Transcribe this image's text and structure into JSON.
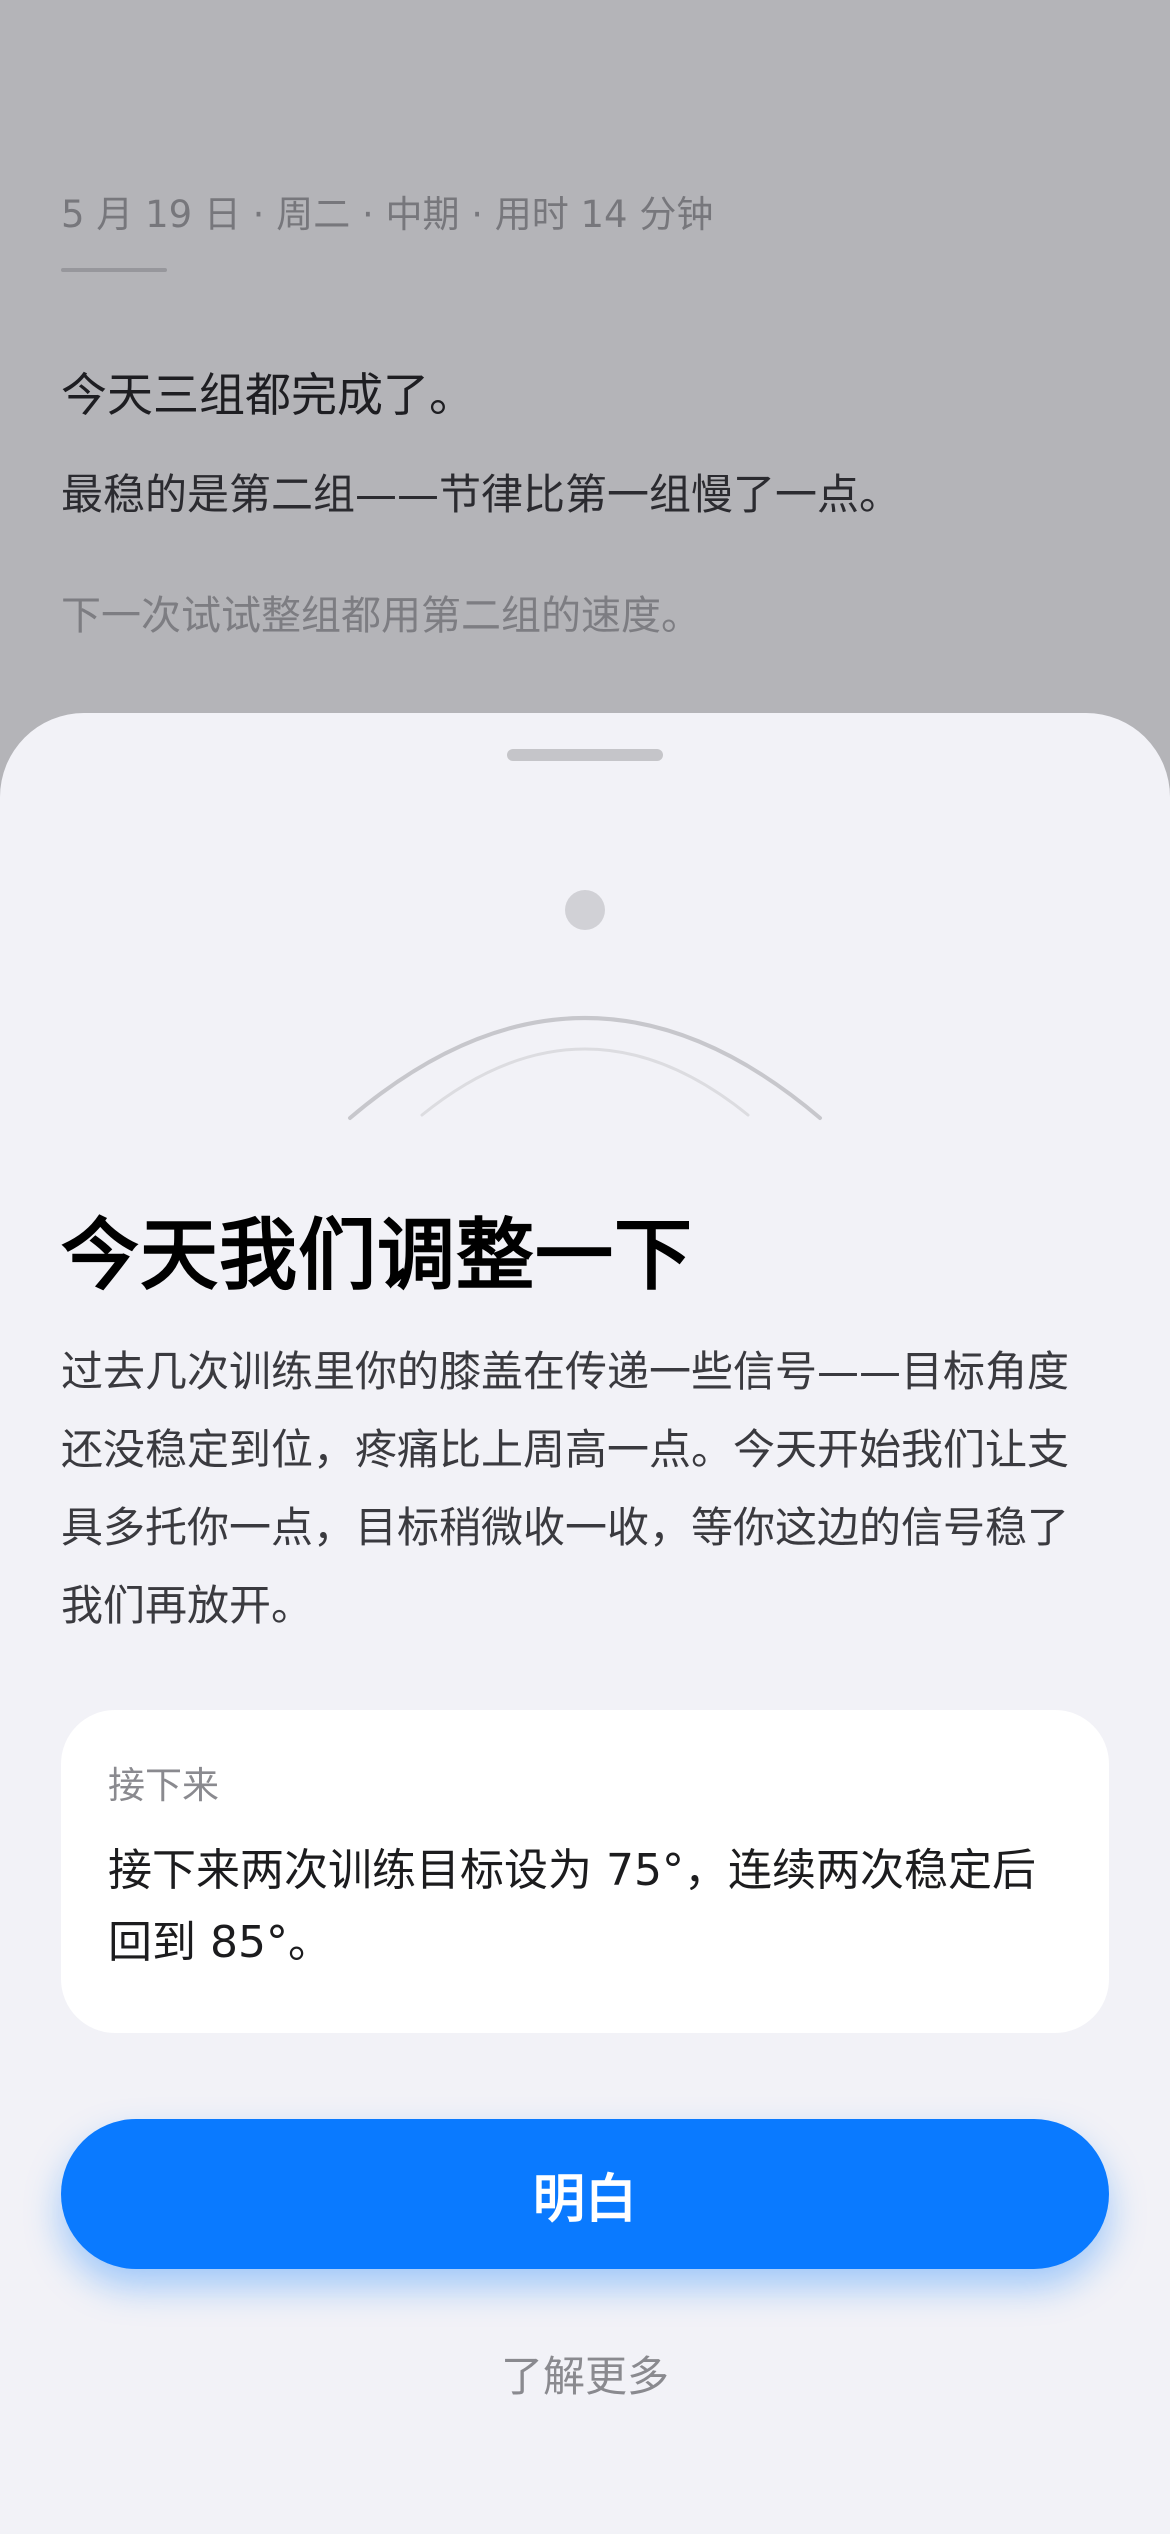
{
  "background": {
    "meta": "5 月 19 日 · 周二 · 中期 · 用时 14 分钟",
    "headline": "今天三组都完成了。",
    "body": "最稳的是第二组——节律比第一组慢了一点。",
    "hint": "下一次试试整组都用第二组的速度。"
  },
  "sheet": {
    "title": "今天我们调整一下",
    "body": "过去几次训练里你的膝盖在传递一些信号——目标角度还没稳定到位，疼痛比上周高一点。今天开始我们让支具多托你一点，目标稍微收一收，等你这边的信号稳了我们再放开。",
    "next_card": {
      "label": "接下来",
      "text": "接下来两次训练目标设为 75°，连续两次稳定后回到 85°。"
    },
    "primary_button": "明白",
    "secondary_link": "了解更多"
  },
  "colors": {
    "accent": "#0a7aff",
    "dim_background": "#b4b4b8",
    "sheet_background": "#f2f2f7"
  },
  "icons": {
    "illustration": "knee-arc-icon"
  }
}
